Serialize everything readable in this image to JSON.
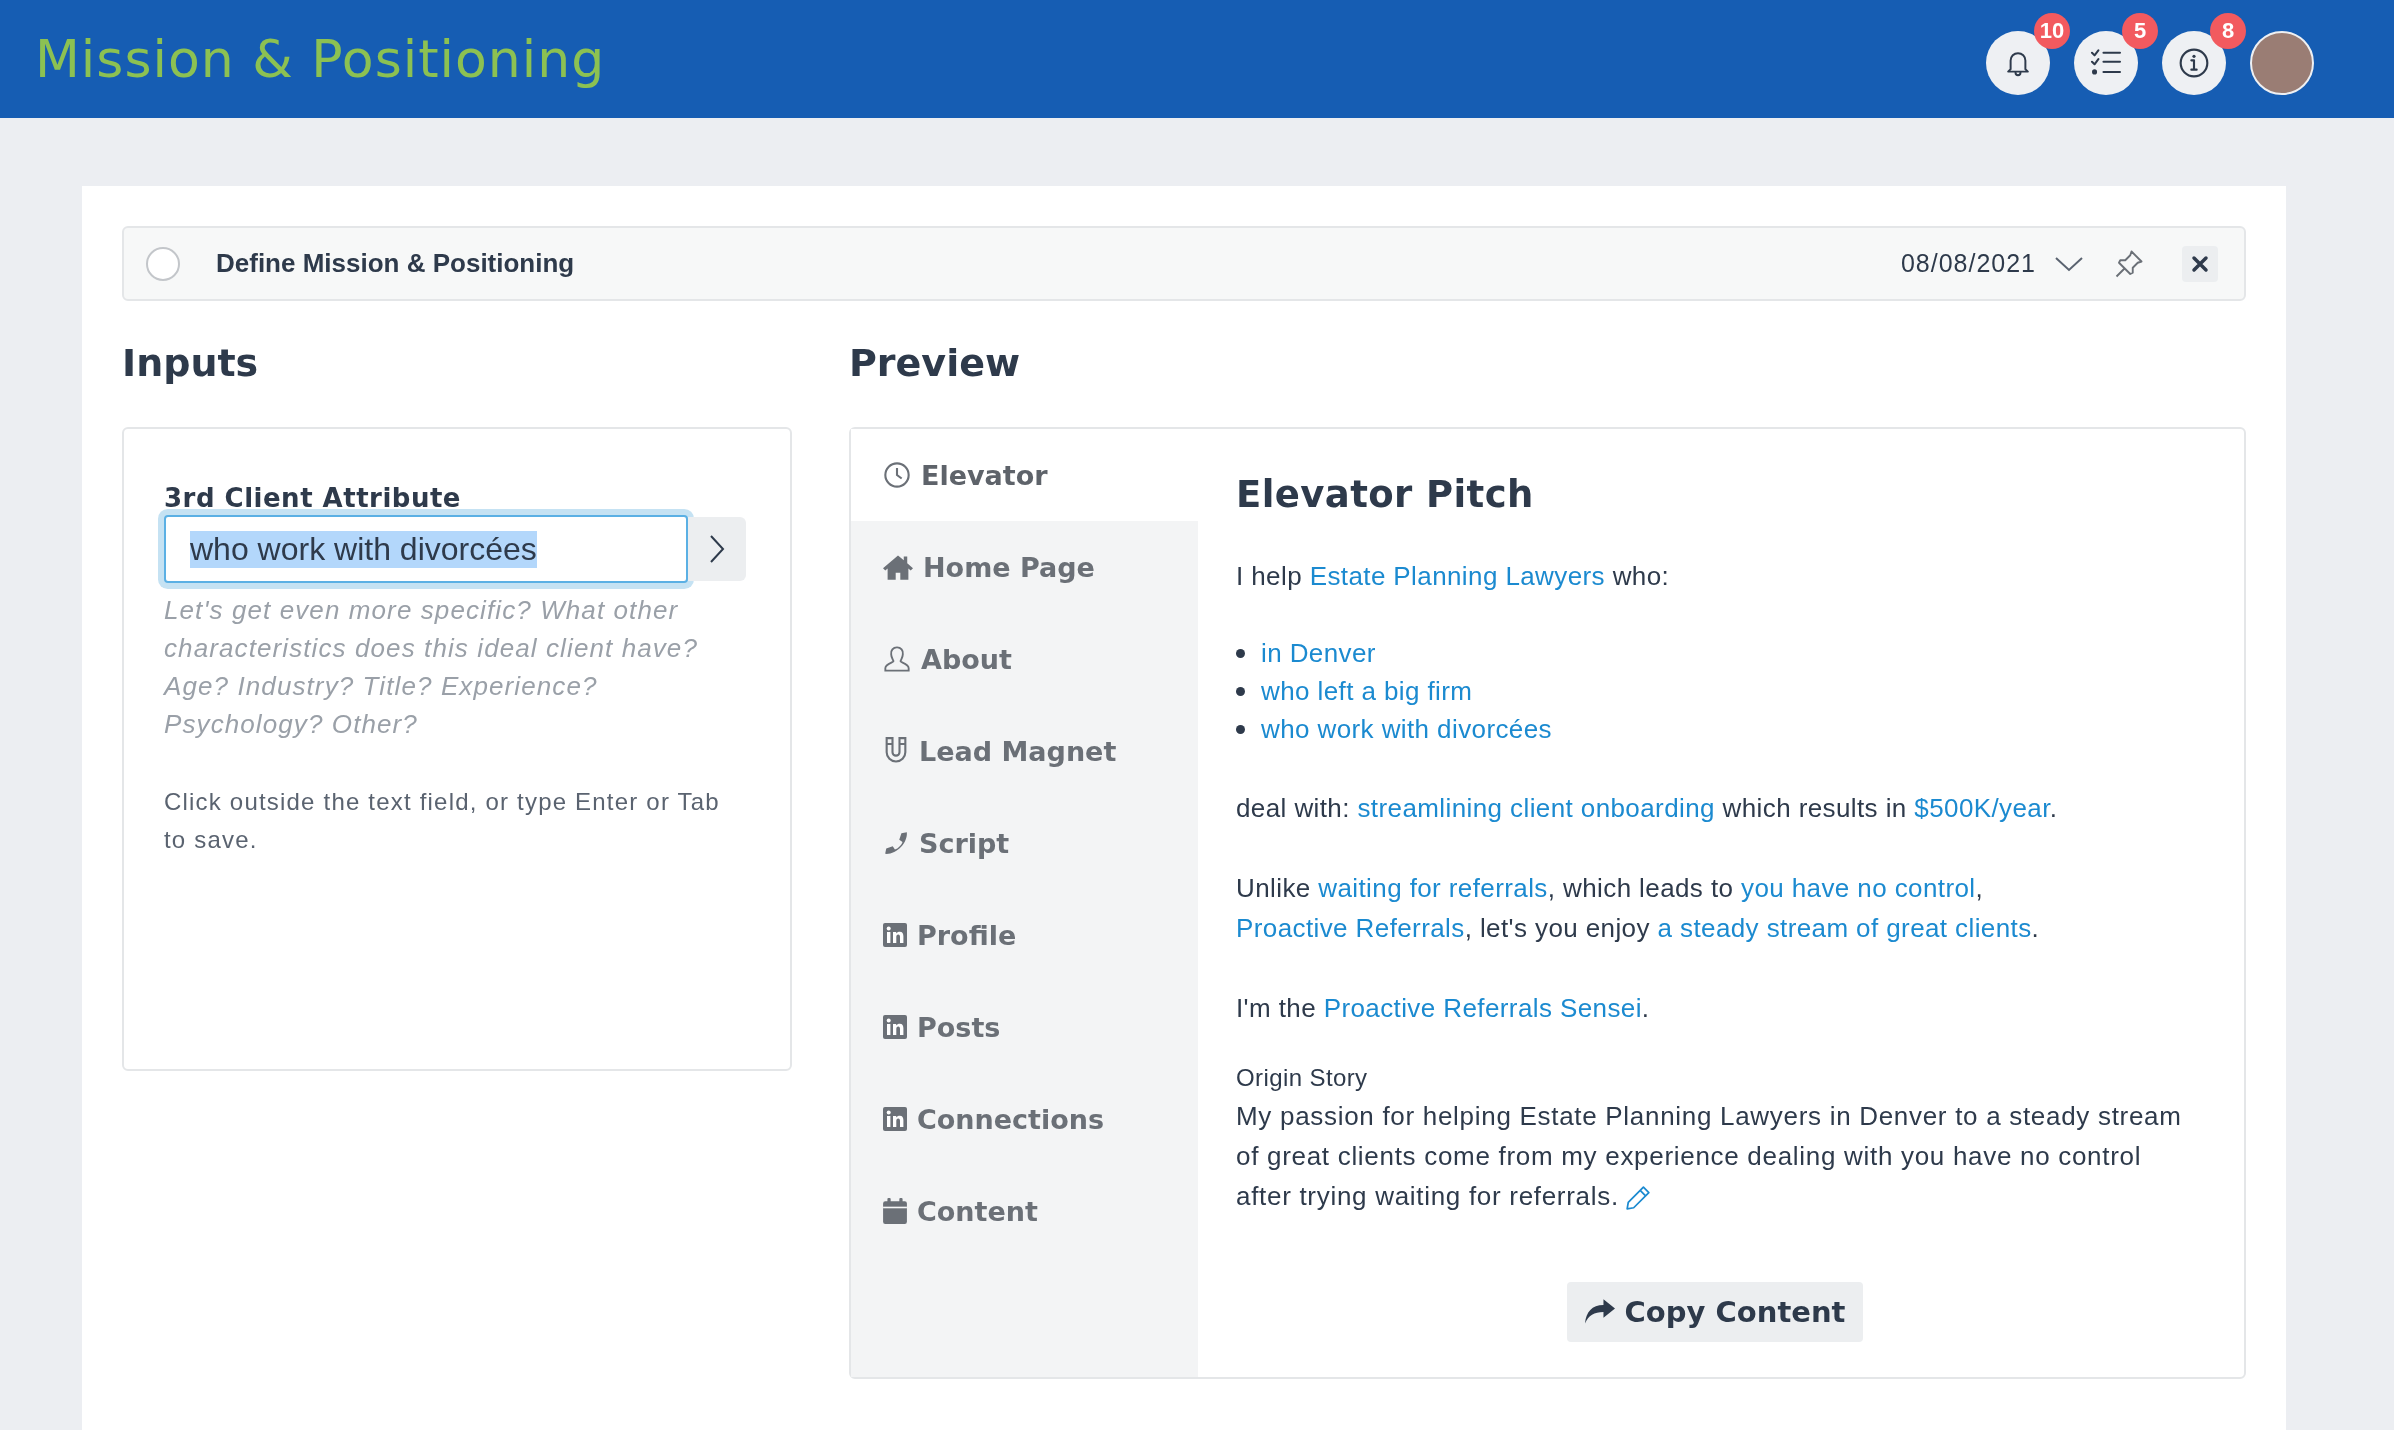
{
  "header": {
    "title": "Mission & Positioning",
    "buttons": [
      {
        "kind": "bell",
        "count": "10"
      },
      {
        "kind": "checklist",
        "count": "5"
      },
      {
        "kind": "info",
        "count": "8"
      }
    ]
  },
  "task": {
    "title": "Define Mission & Positioning",
    "done": false,
    "date": "08/08/2021"
  },
  "inputs": {
    "heading": "Inputs",
    "field": {
      "label": "3rd Client Attribute",
      "value": "who work with divorcées",
      "focused": true,
      "text_selected": true
    },
    "hint": "Let's get even more specific? What other characteristics does this ideal client have? Age? Industry? Title? Experience? Psychology? Other?",
    "note": "Click outside the text field, or type Enter or Tab to save."
  },
  "preview": {
    "heading": "Preview",
    "tabs": [
      {
        "label": "Elevator",
        "kind": "clock",
        "selected": true
      },
      {
        "label": "Home Page",
        "kind": "home",
        "selected": false
      },
      {
        "label": "About",
        "kind": "person",
        "selected": false
      },
      {
        "label": "Lead Magnet",
        "kind": "magnet",
        "selected": false
      },
      {
        "label": "Script",
        "kind": "phone",
        "selected": false
      },
      {
        "label": "Profile",
        "kind": "linkedin",
        "selected": false
      },
      {
        "label": "Posts",
        "kind": "linkedin",
        "selected": false
      },
      {
        "label": "Connections",
        "kind": "linkedin",
        "selected": false
      },
      {
        "label": "Content",
        "kind": "calendar",
        "selected": false
      }
    ],
    "title": "Elevator Pitch",
    "blocks": [
      {
        "kind": "paragraph",
        "segments": [
          {
            "kind": "text",
            "text": "I help "
          },
          {
            "kind": "link",
            "text": "Estate Planning Lawyers"
          },
          {
            "kind": "text",
            "text": " who:"
          }
        ]
      },
      {
        "kind": "bullets",
        "items": [
          "in Denver",
          "who left a big firm",
          "who work with divorcées"
        ]
      },
      {
        "kind": "paragraph",
        "segments": [
          {
            "kind": "text",
            "text": "deal with: "
          },
          {
            "kind": "link",
            "text": "streamlining client onboarding"
          },
          {
            "kind": "text",
            "text": " which results in "
          },
          {
            "kind": "link",
            "text": "$500K/year"
          },
          {
            "kind": "text",
            "text": "."
          }
        ]
      },
      {
        "kind": "paragraph",
        "segments": [
          {
            "kind": "text",
            "text": "Unlike "
          },
          {
            "kind": "link",
            "text": "waiting for referrals"
          },
          {
            "kind": "text",
            "text": ", which leads to "
          },
          {
            "kind": "link",
            "text": "you have no control"
          },
          {
            "kind": "text",
            "text": ", "
          },
          {
            "kind": "link",
            "text": "Proactive Referrals"
          },
          {
            "kind": "text",
            "text": ", let's you enjoy "
          },
          {
            "kind": "link",
            "text": "a steady stream of great clients"
          },
          {
            "kind": "text",
            "text": "."
          }
        ]
      },
      {
        "kind": "paragraph",
        "segments": [
          {
            "kind": "text",
            "text": "I'm the "
          },
          {
            "kind": "link",
            "text": "Proactive Referrals Sensei"
          },
          {
            "kind": "text",
            "text": "."
          }
        ]
      },
      {
        "kind": "story",
        "label": "Origin Story",
        "text": "My passion for helping Estate Planning Lawyers in Denver to a steady stream of great clients come from my experience dealing with you have no control after trying waiting for referrals."
      }
    ],
    "copy_button": "Copy Content"
  }
}
